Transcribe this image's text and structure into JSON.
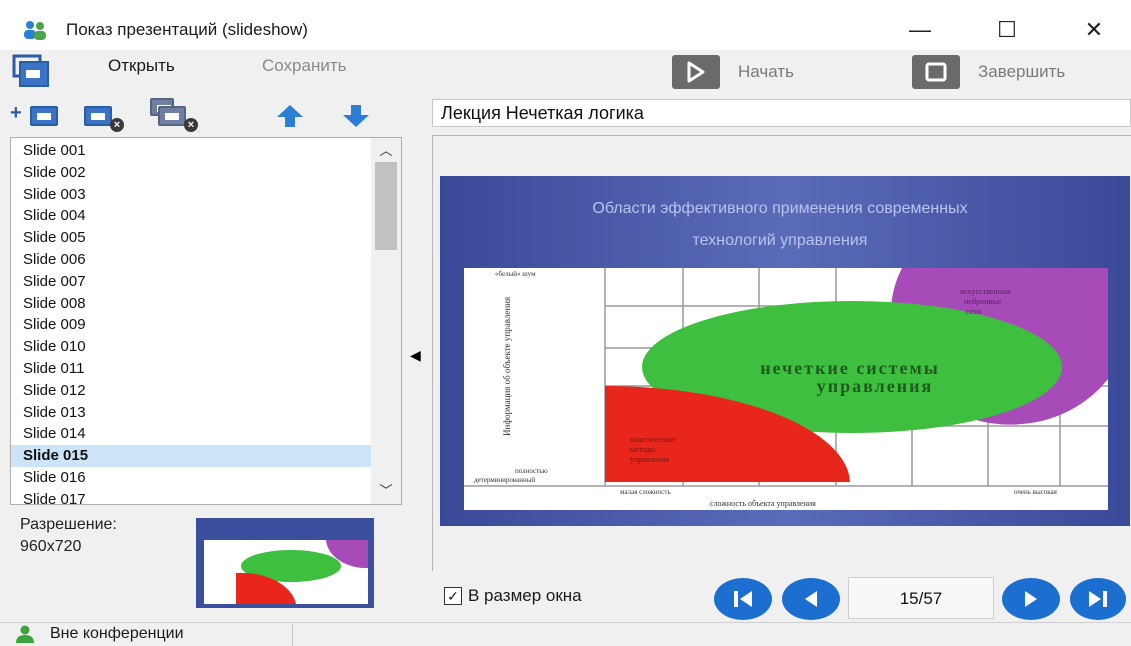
{
  "window": {
    "title": "Показ презентаций (slideshow)",
    "minimize_symbol": "—",
    "maximize_symbol": "☐",
    "close_symbol": "✕"
  },
  "toolbar": {
    "open_label": "Открыть",
    "save_label": "Сохранить",
    "start_label": "Начать",
    "stop_label": "Завершить"
  },
  "presentation": {
    "title_value": "Лекция Нечеткая логика"
  },
  "slides": {
    "items": [
      "Slide 001",
      "Slide 002",
      "Slide 003",
      "Slide 004",
      "Slide 005",
      "Slide 006",
      "Slide 007",
      "Slide 008",
      "Slide 009",
      "Slide 010",
      "Slide 011",
      "Slide 012",
      "Slide 013",
      "Slide 014",
      "Slide 015",
      "Slide 016",
      "Slide 017"
    ],
    "selected": "Slide 015"
  },
  "info": {
    "resolution_label": "Разрешение:",
    "resolution_value": "960x720"
  },
  "slide_preview": {
    "heading_line1": "Области эффективного применения современных",
    "heading_line2": "технологий управления",
    "y_axis_label": "Информация об объекте управления",
    "top_left_label": "«белый» шум",
    "bottom_left_label_1": "полностью",
    "bottom_left_label_2": "детерминированный",
    "x_low": "малая сложность",
    "x_axis_label": "сложность объекта управления",
    "x_high": "очень высокая",
    "green_label_1": "нечеткие системы",
    "green_label_2": "управления",
    "red_label_1": "классические",
    "red_label_2": "методы",
    "red_label_3": "управления",
    "purple_label_1": "искусственные",
    "purple_label_2": "нейронные",
    "purple_label_3": "сети",
    "colors": {
      "background": "#3c4f9e",
      "green": "#3fbf3f",
      "red": "#e8261c",
      "purple": "#a74bb8"
    }
  },
  "controls": {
    "fit_window_label": "В размер окна",
    "fit_window_checked": true,
    "page_indicator": "15/57"
  },
  "status": {
    "text": "Вне конференции"
  }
}
